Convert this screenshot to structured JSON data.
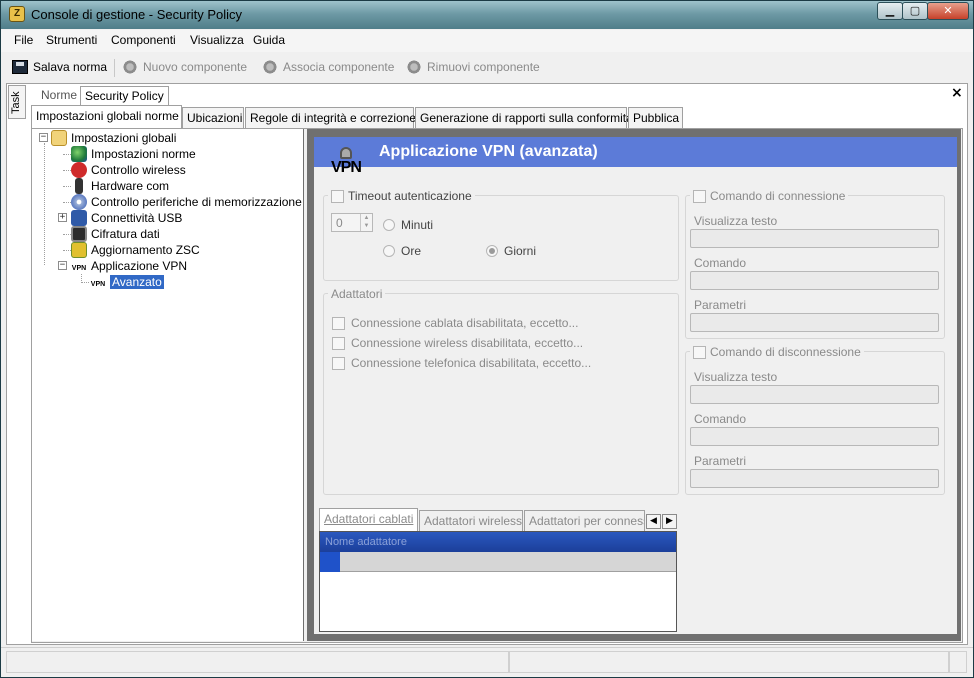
{
  "window": {
    "title": "Console di gestione  - Security Policy",
    "app_icon_glyph": "Z",
    "min_glyph": "▁",
    "max_glyph": "▢",
    "close_glyph": "✕"
  },
  "menu": [
    "File",
    "Strumenti",
    "Componenti",
    "Visualizza",
    "Guida"
  ],
  "toolbar": {
    "save": "Salava norma",
    "new_component": "Nuovo componente",
    "associate_component": "Associa componente",
    "remove_component": "Rimuovi componente"
  },
  "side_panel": {
    "task_label": "Task"
  },
  "top_tabs": {
    "norme": "Norme",
    "security_policy": "Security Policy",
    "close_glyph": "×"
  },
  "sub_tabs": [
    "Impostazioni globali norme",
    "Ubicazioni",
    "Regole di integrità e correzione",
    "Generazione di rapporti sulla conformità",
    "Pubblica"
  ],
  "tree": {
    "root": "Impostazioni globali",
    "items": [
      "Impostazioni norme",
      "Controllo wireless",
      "Hardware com",
      "Controllo periferiche di memorizzazione",
      "Connettività USB",
      "Cifratura dati",
      "Aggiornamento ZSC",
      "Applicazione VPN"
    ],
    "child_selected": "Avanzato"
  },
  "vpn": {
    "header": "Applicazione VPN (avanzata)",
    "logo_text": "VPN",
    "timeout_label": "Timeout autenticazione",
    "spin_value": "0",
    "radio_minuti": "Minuti",
    "radio_ore": "Ore",
    "radio_giorni": "Giorni",
    "adapters_group": "Adattatori",
    "wired_disabled": "Connessione cablata disabilitata, eccetto...",
    "wireless_disabled": "Connessione wireless disabilitata, eccetto...",
    "dialup_disabled": "Connessione telefonica disabilitata, eccetto...",
    "connect_group": "Comando di connessione",
    "disconnect_group": "Comando di disconnessione",
    "show_text": "Visualizza testo",
    "command": "Comando",
    "parameters": "Parametri"
  },
  "bottom_tabs": [
    "Adattatori cablati",
    "Adattatori wireless",
    "Adattatori per connessi"
  ],
  "grid": {
    "column": "Nome adattatore"
  },
  "arrows": {
    "left": "◀",
    "right": "▶"
  },
  "colors": {
    "header_blue": "#5c7bd8",
    "selection_blue": "#3169c6"
  }
}
